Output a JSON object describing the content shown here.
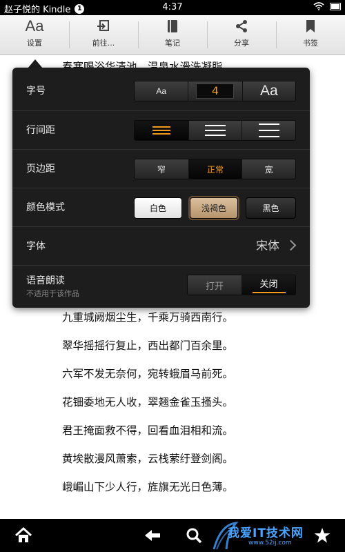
{
  "status_bar": {
    "title": "赵子悦的 Kindle",
    "notification_count": "1",
    "time": "4:37"
  },
  "toolbar": {
    "items": [
      {
        "label": "设置",
        "icon": "aa-icon"
      },
      {
        "label": "前往...",
        "icon": "goto-icon"
      },
      {
        "label": "笔记",
        "icon": "notes-icon"
      },
      {
        "label": "分享",
        "icon": "share-icon"
      },
      {
        "label": "书签",
        "icon": "bookmark-icon"
      }
    ],
    "settings_glyph": "Aa"
  },
  "reading": {
    "partial_top_line": "春寒赐浴华清池，温泉水滑洗凝脂",
    "lines": [
      "九重城阙烟尘生，千乘万骑西南行。",
      "翠华摇摇行复止，西出都门百余里。",
      "六军不发无奈何，宛转蛾眉马前死。",
      "花钿委地无人收，翠翘金雀玉搔头。",
      "君王掩面救不得，回看血泪相和流。",
      "黄埃散漫风萧索，云栈萦纡登剑阁。",
      "峨嵋山下少人行，旌旗无光日色薄。"
    ]
  },
  "settings": {
    "font_size": {
      "label": "字号",
      "small": "Aa",
      "value": "4",
      "large": "Aa"
    },
    "line_spacing": {
      "label": "行间距",
      "selected": "tight"
    },
    "margins": {
      "label": "页边距",
      "options": [
        "窄",
        "正常",
        "宽"
      ],
      "selected": "正常"
    },
    "color_mode": {
      "label": "颜色模式",
      "options": [
        "白色",
        "浅褐色",
        "黑色"
      ],
      "selected": "浅褐色"
    },
    "typeface": {
      "label": "字体",
      "value": "宋体"
    },
    "text_to_speech": {
      "label": "语音朗读",
      "sublabel": "不适用于该作品",
      "on": "打开",
      "off": "关闭",
      "selected": "关闭"
    }
  },
  "bottom_bar": {
    "icons": [
      "home-icon",
      "back-icon",
      "search-icon",
      "favorites-icon"
    ]
  },
  "watermark": {
    "text": "我爱IT技术网",
    "sub": "www.52ij.com"
  },
  "colors": {
    "accent": "#f29a1d",
    "panel_bg": "#1d1d1d",
    "toolbar_bg": "#eeeeee"
  }
}
